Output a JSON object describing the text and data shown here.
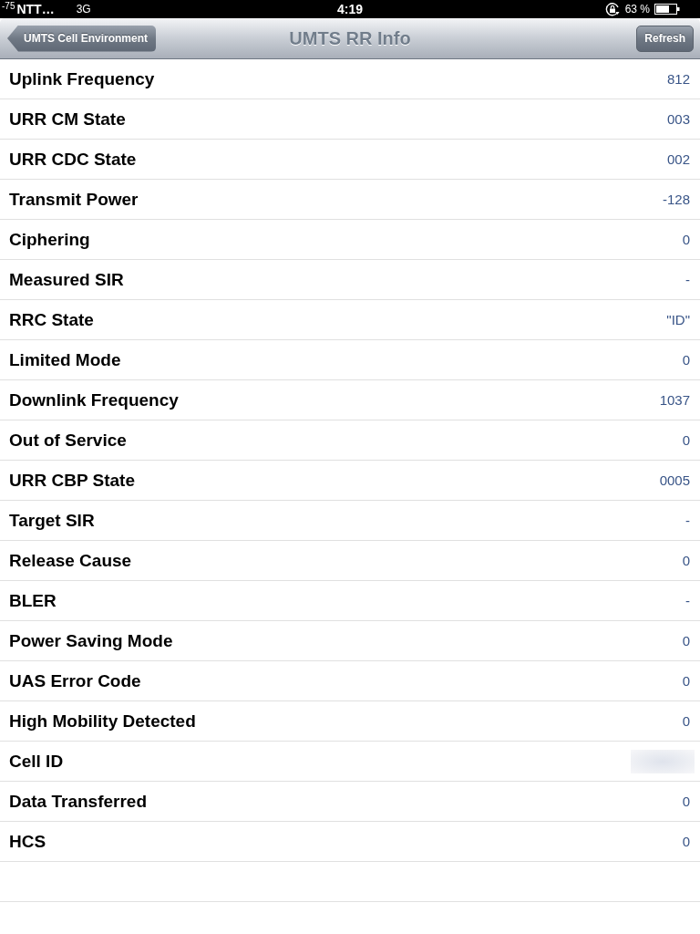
{
  "status_bar": {
    "signal": "-75",
    "carrier": "NTT…",
    "network": "3G",
    "time": "4:19",
    "battery": "63 %"
  },
  "nav_bar": {
    "back_button": "UMTS Cell Environment",
    "title": "UMTS RR Info",
    "action_button": "Refresh"
  },
  "rows": [
    {
      "kind": "value",
      "label": "Uplink Frequency",
      "value": "812"
    },
    {
      "kind": "value",
      "label": "URR CM State",
      "value": "003"
    },
    {
      "kind": "value",
      "label": "URR CDC State",
      "value": "002"
    },
    {
      "kind": "value",
      "label": "Transmit Power",
      "value": "-128"
    },
    {
      "kind": "value",
      "label": "Ciphering",
      "value": "0"
    },
    {
      "kind": "value",
      "label": "Measured SIR",
      "value": "-"
    },
    {
      "kind": "value",
      "label": "RRC State",
      "value": "\"ID\""
    },
    {
      "kind": "value",
      "label": "Limited Mode",
      "value": "0"
    },
    {
      "kind": "value",
      "label": "Downlink Frequency",
      "value": "1037"
    },
    {
      "kind": "value",
      "label": "Out of Service",
      "value": "0"
    },
    {
      "kind": "value",
      "label": "URR CBP State",
      "value": "0005"
    },
    {
      "kind": "value",
      "label": "Target SIR",
      "value": "-"
    },
    {
      "kind": "value",
      "label": "Release Cause",
      "value": "0"
    },
    {
      "kind": "value",
      "label": "BLER",
      "value": "-"
    },
    {
      "kind": "value",
      "label": "Power Saving Mode",
      "value": "0"
    },
    {
      "kind": "value",
      "label": "UAS Error Code",
      "value": "0"
    },
    {
      "kind": "value",
      "label": "High Mobility Detected",
      "value": "0"
    },
    {
      "kind": "redacted",
      "label": "Cell ID"
    },
    {
      "kind": "value",
      "label": "Data Transferred",
      "value": "0"
    },
    {
      "kind": "value",
      "label": "HCS",
      "value": "0"
    }
  ]
}
